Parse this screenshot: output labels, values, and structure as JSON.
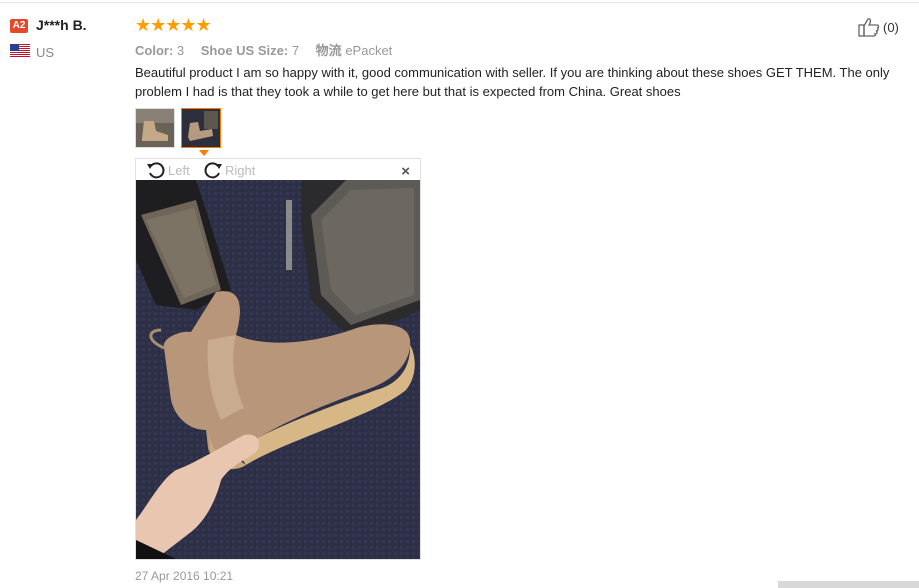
{
  "reviewer": {
    "badge": "A2",
    "name": "J***h B.",
    "country": "US"
  },
  "rating": {
    "stars": 5,
    "stars_text": "★★★★★"
  },
  "attributes": [
    {
      "key": "Color:",
      "value": "3"
    },
    {
      "key": "Shoe US Size:",
      "value": "7"
    },
    {
      "key": "物流",
      "value": "ePacket"
    }
  ],
  "review_text": "Beautiful product I am so happy with it, good communication with seller. If you are thinking about these shoes GET THEM. The only problem I had is that they took a while to get here but that is expected from China. Great shoes",
  "viewer": {
    "rotate_left_label": "Left",
    "rotate_right_label": "Right",
    "close_label": "×"
  },
  "helpful": {
    "count_label": "(0)"
  },
  "date": "27 Apr 2016 10:21",
  "colors": {
    "star": "#ff9c00",
    "accent": "#ff7a00",
    "badge": "#e24a2a"
  }
}
